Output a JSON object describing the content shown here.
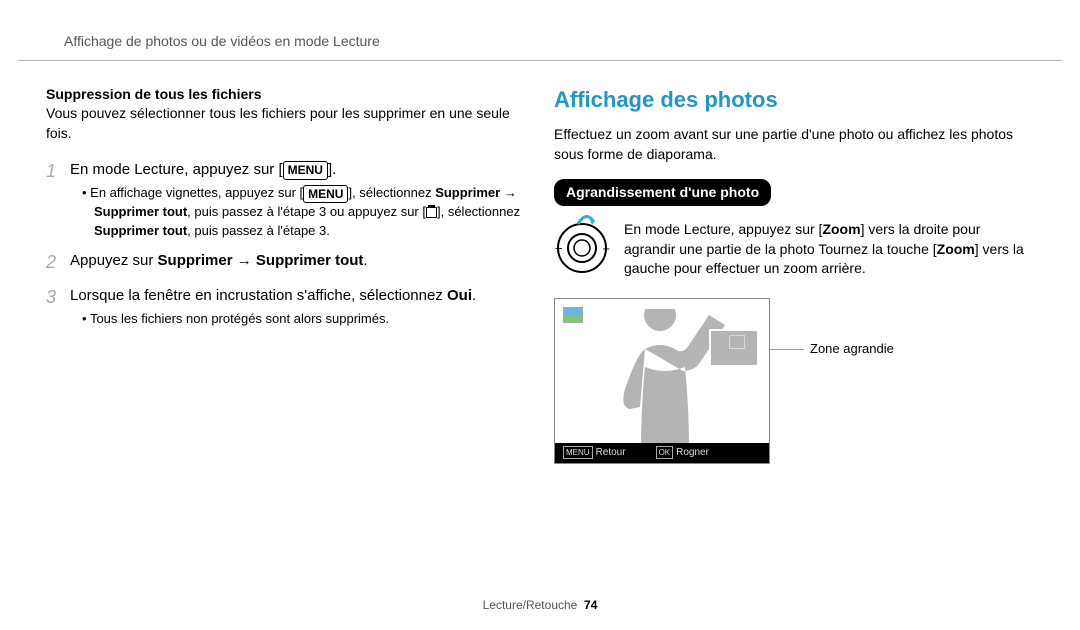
{
  "header": {
    "breadcrumb": "Affichage de photos ou de vidéos en mode Lecture"
  },
  "left": {
    "subheading": "Suppression de tous les fichiers",
    "intro": "Vous pouvez sélectionner tous les fichiers pour les supprimer en une seule fois.",
    "steps": [
      {
        "n": "1",
        "prefix": "En mode Lecture, appuyez sur [",
        "key": "MENU",
        "suffix": "].",
        "bullets": [
          {
            "pre": "En affichage vignettes, appuyez sur [",
            "key": "MENU",
            "mid": "], sélectionnez ",
            "b1": "Supprimer",
            "arrow": " → ",
            "b2": "Supprimer tout",
            "mid2": ", puis passez à l'étape 3 ou appuyez sur [",
            "icon": "trash",
            "mid3": "], sélectionnez ",
            "b3": "Supprimer tout",
            "tail": ", puis passez à l'étape 3."
          }
        ]
      },
      {
        "n": "2",
        "prefix": "Appuyez sur ",
        "b1": "Supprimer",
        "arrow": " → ",
        "b2": "Supprimer tout",
        "suffix": "."
      },
      {
        "n": "3",
        "prefix": "Lorsque la fenêtre en incrustation s'affiche, sélectionnez ",
        "b1": "Oui",
        "suffix": ".",
        "bullets_plain": [
          "Tous les fichiers non protégés sont alors supprimés."
        ]
      }
    ]
  },
  "right": {
    "heading": "Affichage des photos",
    "intro": "Effectuez un zoom avant sur une partie d'une photo ou affichez les photos sous forme de diaporama.",
    "pill": "Agrandissement d'une photo",
    "zoom_text": {
      "pre": "En mode Lecture, appuyez sur [",
      "b1": "Zoom",
      "mid": "] vers la droite pour agrandir une partie de la photo Tournez la touche [",
      "b2": "Zoom",
      "tail": "] vers la gauche pour effectuer un zoom arrière."
    },
    "dial": {
      "minus": "−",
      "plus": "+"
    },
    "callout": "Zone agrandie",
    "bottom_bar": {
      "left_key": "MENU",
      "left_label": "Retour",
      "right_key": "OK",
      "right_label": "Rogner"
    }
  },
  "footer": {
    "section": "Lecture/Retouche",
    "page": "74"
  }
}
